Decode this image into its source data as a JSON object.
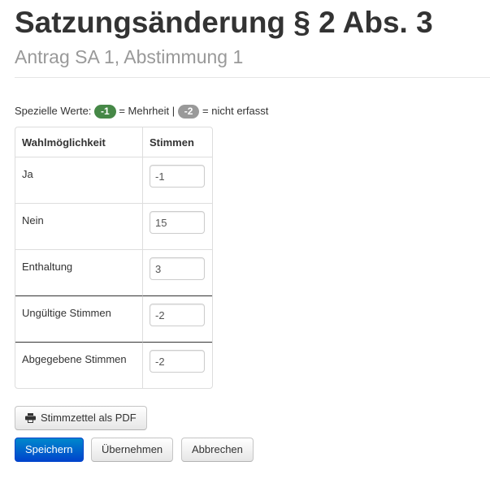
{
  "header": {
    "title": "Satzungsänderung § 2 Abs. 3",
    "subtitle": "Antrag SA 1, Abstimmung 1"
  },
  "special_values": {
    "prefix": "Spezielle Werte:",
    "majority_badge": "-1",
    "majority_text": "= Mehrheit |",
    "not_recorded_badge": "-2",
    "not_recorded_text": "= nicht erfasst"
  },
  "table": {
    "headers": {
      "option": "Wahlmöglichkeit",
      "votes": "Stimmen"
    },
    "rows": [
      {
        "option": "Ja",
        "votes": "-1"
      },
      {
        "option": "Nein",
        "votes": "15"
      },
      {
        "option": "Enthaltung",
        "votes": "3"
      },
      {
        "option": "Ungültige Stimmen",
        "votes": "-2"
      },
      {
        "option": "Abgegebene Stimmen",
        "votes": "-2"
      }
    ]
  },
  "buttons": {
    "pdf": "Stimmzettel als PDF",
    "save": "Speichern",
    "apply": "Übernehmen",
    "cancel": "Abbrechen"
  },
  "icons": {
    "pdf": "print-icon"
  },
  "colors": {
    "primary": "#0055cc",
    "badge_green": "#468847",
    "badge_grey": "#999999",
    "subtitle": "#999999"
  }
}
